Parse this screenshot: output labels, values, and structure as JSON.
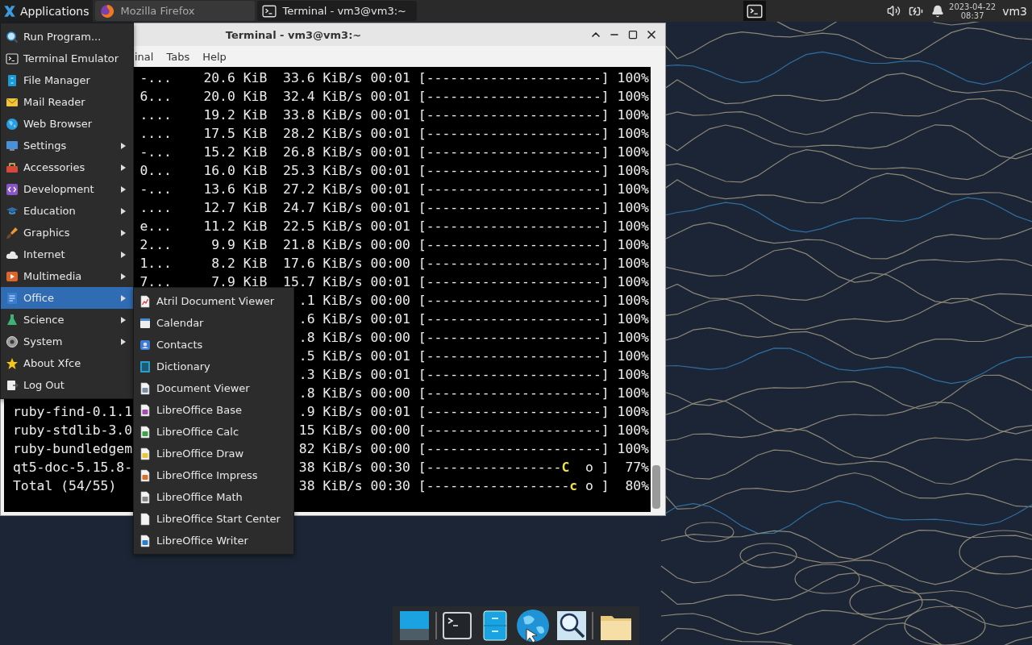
{
  "top_panel": {
    "menu_button": "Applications",
    "tasks": [
      {
        "title": "Mozilla Firefox",
        "kind": "browser"
      },
      {
        "title": "Terminal - vm3@vm3:~",
        "kind": "terminal"
      }
    ],
    "clock": {
      "date": "2023-04-22",
      "time": "08:37"
    },
    "user": "vm3"
  },
  "terminal": {
    "title": "Terminal - vm3@vm3:~",
    "menu": [
      "inal",
      "Tabs",
      "Help"
    ],
    "lines": [
      {
        "right": "-...    20.6 KiB  33.6 KiB/s 00:01 [----------------------] 100%"
      },
      {
        "right": "6...    20.0 KiB  32.4 KiB/s 00:01 [----------------------] 100%"
      },
      {
        "right": "....    19.2 KiB  33.8 KiB/s 00:01 [----------------------] 100%"
      },
      {
        "right": "....    17.5 KiB  28.2 KiB/s 00:01 [----------------------] 100%"
      },
      {
        "right": "-...    15.2 KiB  26.8 KiB/s 00:01 [----------------------] 100%"
      },
      {
        "right": "0...    16.0 KiB  25.3 KiB/s 00:01 [----------------------] 100%"
      },
      {
        "right": "-...    13.6 KiB  27.2 KiB/s 00:01 [----------------------] 100%"
      },
      {
        "right": "....    12.7 KiB  24.7 KiB/s 00:01 [----------------------] 100%"
      },
      {
        "right": "e...    11.2 KiB  22.5 KiB/s 00:01 [----------------------] 100%"
      },
      {
        "right": "2...     9.9 KiB  21.8 KiB/s 00:00 [----------------------] 100%"
      },
      {
        "right": "1...     8.2 KiB  17.6 KiB/s 00:00 [----------------------] 100%"
      },
      {
        "right": "7...     7.9 KiB  15.7 KiB/s 00:01 [----------------------] 100%"
      },
      {
        "right": ".1 KiB/s 00:00 [----------------------] 100%"
      },
      {
        "right": ".6 KiB/s 00:01 [----------------------] 100%"
      },
      {
        "right": ".8 KiB/s 00:00 [----------------------] 100%"
      },
      {
        "right": ".5 KiB/s 00:01 [----------------------] 100%"
      },
      {
        "right": ".3 KiB/s 00:01 [----------------------] 100%"
      },
      {
        "right": ".8 KiB/s 00:00 [----------------------] 100%"
      },
      {
        "left": "ruby-find-0.1.1",
        "right": ".9 KiB/s 00:01 [----------------------] 100%"
      },
      {
        "left": "ruby-stdlib-3.0",
        "right": "15 KiB/s 00:00 [----------------------] 100%"
      },
      {
        "left": "ruby-bundledgem",
        "right": "82 KiB/s 00:00 [----------------------] 100%"
      },
      {
        "left": "qt5-doc-5.15.8-",
        "right": "38 KiB/s 00:30 [-----------------**C**  o ]  77%"
      },
      {
        "left": "Total (54/55)",
        "right": "38 KiB/s 00:30 [------------------**c** o ]  80%"
      }
    ]
  },
  "app_menu": {
    "items": [
      {
        "label": "Run Program...",
        "submenu": false,
        "selected": false
      },
      {
        "label": "Terminal Emulator",
        "submenu": false,
        "selected": false
      },
      {
        "label": "File Manager",
        "submenu": false,
        "selected": false
      },
      {
        "label": "Mail Reader",
        "submenu": false,
        "selected": false
      },
      {
        "label": "Web Browser",
        "submenu": false,
        "selected": false
      },
      {
        "label": "Settings",
        "submenu": true,
        "selected": false
      },
      {
        "label": "Accessories",
        "submenu": true,
        "selected": false
      },
      {
        "label": "Development",
        "submenu": true,
        "selected": false
      },
      {
        "label": "Education",
        "submenu": true,
        "selected": false
      },
      {
        "label": "Graphics",
        "submenu": true,
        "selected": false
      },
      {
        "label": "Internet",
        "submenu": true,
        "selected": false
      },
      {
        "label": "Multimedia",
        "submenu": true,
        "selected": false
      },
      {
        "label": "Office",
        "submenu": true,
        "selected": true
      },
      {
        "label": "Science",
        "submenu": true,
        "selected": false
      },
      {
        "label": "System",
        "submenu": true,
        "selected": false
      },
      {
        "label": "About Xfce",
        "submenu": false,
        "selected": false
      },
      {
        "label": "Log Out",
        "submenu": false,
        "selected": false
      }
    ]
  },
  "office_submenu": {
    "items": [
      {
        "label": "Atril Document Viewer",
        "selected": false
      },
      {
        "label": "Calendar",
        "selected": false
      },
      {
        "label": "Contacts",
        "selected": false
      },
      {
        "label": "Dictionary",
        "selected": false
      },
      {
        "label": "Document Viewer",
        "selected": false
      },
      {
        "label": "LibreOffice Base",
        "selected": false
      },
      {
        "label": "LibreOffice Calc",
        "selected": false
      },
      {
        "label": "LibreOffice Draw",
        "selected": false
      },
      {
        "label": "LibreOffice Impress",
        "selected": false
      },
      {
        "label": "LibreOffice Math",
        "selected": false
      },
      {
        "label": "LibreOffice Start Center",
        "selected": false
      },
      {
        "label": "LibreOffice Writer",
        "selected": false
      }
    ]
  }
}
